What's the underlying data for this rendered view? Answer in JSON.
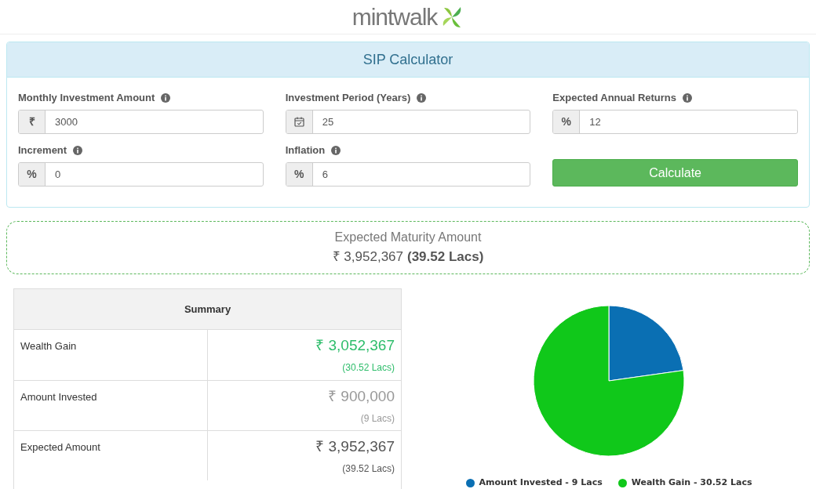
{
  "brand": {
    "name": "mintwalk"
  },
  "calculator": {
    "title": "SIP Calculator",
    "fields": [
      {
        "label": "Monthly Investment Amount",
        "kind": "text",
        "prefix": "₹",
        "value": "3000"
      },
      {
        "label": "Investment Period (Years)",
        "kind": "calendar",
        "value": "25"
      },
      {
        "label": "Expected Annual Returns",
        "kind": "text",
        "prefix": "%",
        "value": "12"
      },
      {
        "label": "Increment",
        "kind": "text",
        "prefix": "%",
        "value": "0"
      },
      {
        "label": "Inflation",
        "kind": "text",
        "prefix": "%",
        "value": "6"
      }
    ],
    "button": "Calculate"
  },
  "maturity": {
    "label": "Expected Maturity Amount",
    "amount": "₹ 3,952,367",
    "lacs": "(39.52 Lacs)"
  },
  "summary": {
    "title": "Summary",
    "rows": [
      {
        "label": "Wealth Gain",
        "amount": "₹ 3,052,367",
        "lacs": "(30.52 Lacs)",
        "color": "#2ebd6b"
      },
      {
        "label": "Amount Invested",
        "amount": "₹ 900,000",
        "lacs": "(9 Lacs)",
        "color": "#999999"
      },
      {
        "label": "Expected Amount",
        "amount": "₹ 3,952,367",
        "lacs": "(39.52 Lacs)",
        "color": "#555555"
      }
    ]
  },
  "chart_data": {
    "type": "pie",
    "categories": [
      "Amount Invested - 9 Lacs",
      "Wealth Gain - 30.52 Lacs"
    ],
    "values": [
      22.77,
      77.23
    ],
    "colors": [
      "#0a6fb3",
      "#10c81a"
    ],
    "legend": true
  }
}
